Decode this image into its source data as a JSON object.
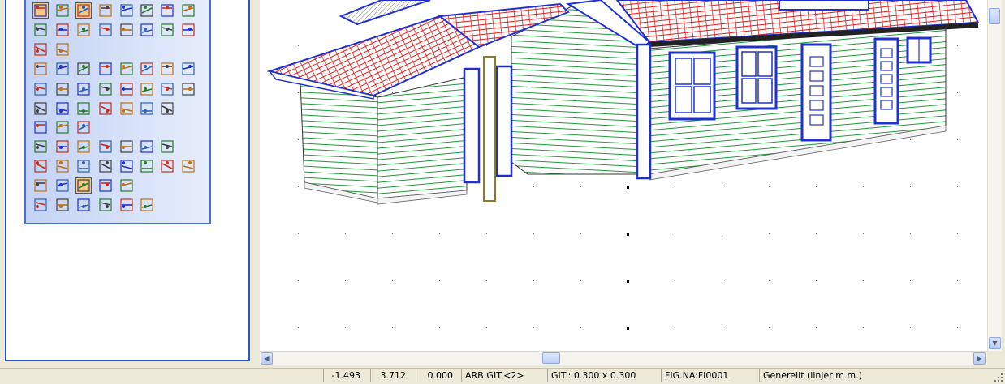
{
  "toolbox": {
    "rows": [
      [
        "tool-new-doc-icon",
        "grid-icon",
        "wall-window-icon",
        "text-marker-icon",
        "window-frame-icon",
        "window-pane-icon",
        "red-grid-icon",
        "blue-panel-icon"
      ],
      [
        "dimension-icon",
        "cross-arrow-icon",
        "line-corner-icon",
        "dashed-line-icon",
        "axis-line-icon",
        "double-line-icon",
        "rotate-icon",
        "cross-box-icon"
      ],
      [
        "hatch-icon",
        "arrow-left-icon"
      ],
      [
        "book-icon",
        "people-icon",
        "yellow-plane-icon",
        "move-icon",
        "copy-icon",
        "circle-box-icon",
        "triangle-box-icon",
        "fence-icon"
      ],
      [
        "paving-icon",
        "bush-icon",
        "hedge-icon",
        "grass-icon",
        "tree-icon",
        "person-icon",
        "tree-silhouette-icon",
        "dog-icon"
      ],
      [
        "car-icon",
        "car2-icon",
        "bicycle-icon",
        "lamp-icon",
        "stack-icon",
        "building-icon",
        "gate-icon"
      ],
      [
        "terrain-icon",
        "corner-arrow-icon",
        "cross-target-icon"
      ],
      [
        "dim-1-icon",
        "dim-2-icon",
        "dim-3-icon",
        "dim-4-icon",
        "dim-5-icon",
        "dim-6-icon",
        "spring-icon"
      ],
      [
        "roof-1-icon",
        "roof-2-icon",
        "roof-3-icon",
        "roof-4-icon",
        "bracket-1-icon",
        "bracket-2-icon",
        "bracket-3-icon",
        "curve-icon"
      ],
      [
        "pipe-icon",
        "eraser-small-icon",
        "eraser-icon",
        "blocks-icon",
        "blocks-orange-icon"
      ],
      [
        "level-icon",
        "profile-icon",
        "beam-icon",
        "post-icon",
        "water-icon",
        "slope-icon"
      ]
    ]
  },
  "statusbar": {
    "x": "-1.493",
    "y": "3.712",
    "z": "0.000",
    "layer": "ARB:GIT.<2>",
    "grid": "GIT.: 0.300 x 0.300",
    "figure": "FIG.NA:FI0001",
    "mode": "Generellt (linjer m.m.)"
  },
  "colors": {
    "roof": "#e02020",
    "siding": "#0a8a2a",
    "trim": "#2030d0",
    "post": "#8a7a2a",
    "palette_border": "#4a6fd2",
    "frame_border": "#2b56c8"
  }
}
